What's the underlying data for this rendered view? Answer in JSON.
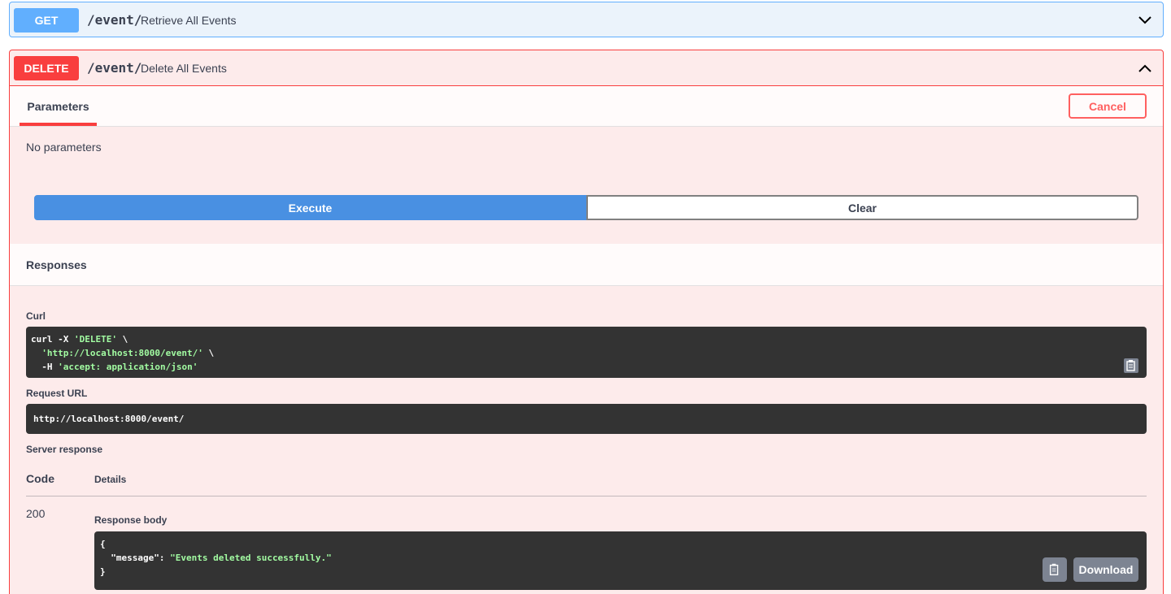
{
  "get_op": {
    "method": "GET",
    "path": "/event/",
    "summary": "Retrieve All Events"
  },
  "delete_op": {
    "method": "DELETE",
    "path": "/event/",
    "summary": "Delete All Events",
    "parameters_tab": "Parameters",
    "cancel_label": "Cancel",
    "no_parameters": "No parameters",
    "execute_label": "Execute",
    "clear_label": "Clear",
    "responses_title": "Responses",
    "curl_label": "Curl",
    "curl_lines": [
      {
        "plain": "curl -X ",
        "str": "'DELETE'",
        "tail": " \\"
      },
      {
        "plain": "  ",
        "str": "'http://localhost:8000/event/'",
        "tail": " \\"
      },
      {
        "plain": "  -H ",
        "str": "'accept: application/json'",
        "tail": ""
      }
    ],
    "request_url_label": "Request URL",
    "request_url": "http://localhost:8000/event/",
    "server_response_label": "Server response",
    "code_header": "Code",
    "details_header": "Details",
    "status_code": "200",
    "response_body_label": "Response body",
    "response_body": {
      "open": "{",
      "key": "\"message\"",
      "colon": ": ",
      "value": "\"Events deleted successfully.\"",
      "close": "}"
    },
    "download_label": "Download"
  },
  "colors": {
    "get_accent": "#61affe",
    "delete_accent": "#f93e3e",
    "execute_bg": "#4990e2",
    "code_bg": "#333333",
    "string_green": "#a2fca2"
  }
}
